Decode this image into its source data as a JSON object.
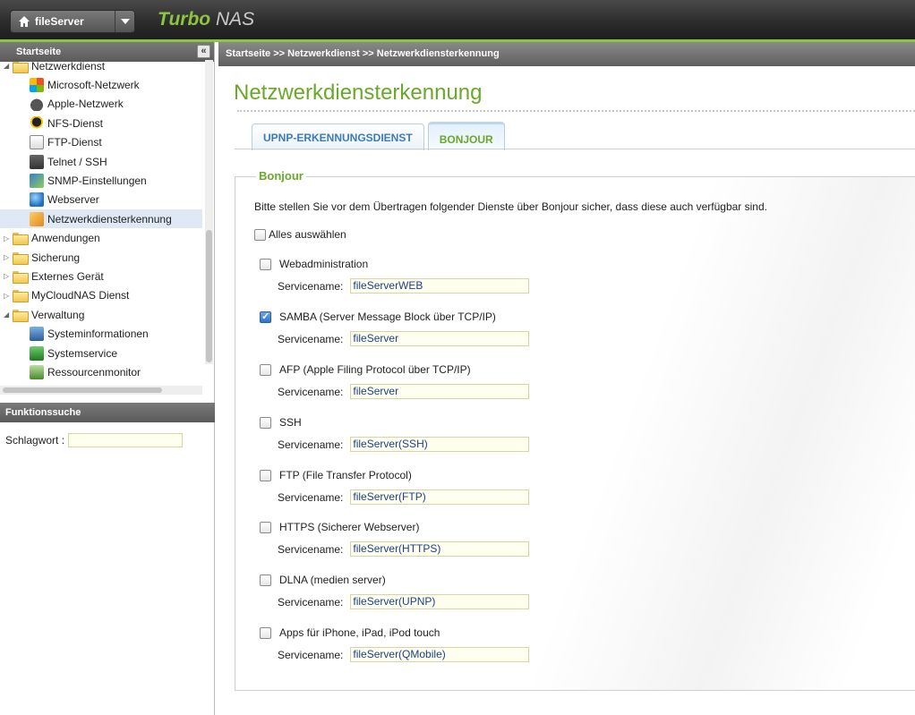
{
  "header": {
    "server_name": "fileServer",
    "brand_main": "Turbo",
    "brand_sub": "NAS"
  },
  "sidebar": {
    "title": "Startseite",
    "collapse_glyph": "«",
    "items": [
      {
        "label": "Netzwerkdienst",
        "type": "folder",
        "expanded": true
      },
      {
        "label": "Microsoft-Netzwerk",
        "type": "leaf",
        "icon": "windows-icon"
      },
      {
        "label": "Apple-Netzwerk",
        "type": "leaf",
        "icon": "apple-icon"
      },
      {
        "label": "NFS-Dienst",
        "type": "leaf",
        "icon": "linux-icon"
      },
      {
        "label": "FTP-Dienst",
        "type": "leaf",
        "icon": "ftp-icon"
      },
      {
        "label": "Telnet / SSH",
        "type": "leaf",
        "icon": "terminal-icon"
      },
      {
        "label": "SNMP-Einstellungen",
        "type": "leaf",
        "icon": "snmp-icon"
      },
      {
        "label": "Webserver",
        "type": "leaf",
        "icon": "globe-icon"
      },
      {
        "label": "Netzwerkdiensterkennung",
        "type": "leaf",
        "icon": "discovery-icon",
        "selected": true
      },
      {
        "label": "Anwendungen",
        "type": "folder",
        "expanded": false
      },
      {
        "label": "Sicherung",
        "type": "folder",
        "expanded": false
      },
      {
        "label": "Externes Gerät",
        "type": "folder",
        "expanded": false
      },
      {
        "label": "MyCloudNAS Dienst",
        "type": "folder",
        "expanded": false
      },
      {
        "label": "Verwaltung",
        "type": "folder",
        "expanded": true
      },
      {
        "label": "Systeminformationen",
        "type": "leaf",
        "icon": "sysinfo-icon"
      },
      {
        "label": "Systemservice",
        "type": "leaf",
        "icon": "sysservice-icon"
      },
      {
        "label": "Ressourcenmonitor",
        "type": "leaf",
        "icon": "monitor-icon"
      }
    ]
  },
  "search": {
    "title": "Funktionssuche",
    "label": "Schlagwort :",
    "value": ""
  },
  "breadcrumb": "Startseite >> Netzwerkdienst >> Netzwerkdiensterkennung",
  "page": {
    "title": "Netzwerkdiensterkennung",
    "tabs": [
      {
        "label": "UPNP-ERKENNUNGSDIENST",
        "active": false
      },
      {
        "label": "BONJOUR",
        "active": true
      }
    ],
    "legend": "Bonjour",
    "description": "Bitte stellen Sie vor dem Übertragen folgender Dienste über Bonjour sicher, dass diese auch verfügbar sind.",
    "select_all_label": "Alles auswählen",
    "select_all_checked": false,
    "service_name_label": "Servicename:",
    "services": [
      {
        "label": "Webadministration",
        "checked": false,
        "service_name": "fileServerWEB"
      },
      {
        "label": "SAMBA (Server Message Block über TCP/IP)",
        "checked": true,
        "service_name": "fileServer"
      },
      {
        "label": "AFP (Apple Filing Protocol über TCP/IP)",
        "checked": false,
        "service_name": "fileServer"
      },
      {
        "label": "SSH",
        "checked": false,
        "service_name": "fileServer(SSH)"
      },
      {
        "label": "FTP (File Transfer Protocol)",
        "checked": false,
        "service_name": "fileServer(FTP)"
      },
      {
        "label": "HTTPS (Sicherer Webserver)",
        "checked": false,
        "service_name": "fileServer(HTTPS)"
      },
      {
        "label": "DLNA (medien server)",
        "checked": false,
        "service_name": "fileServer(UPNP)"
      },
      {
        "label": "Apps für iPhone, iPad, iPod touch",
        "checked": false,
        "service_name": "fileServer(QMobile)"
      }
    ]
  },
  "colors": {
    "accent_green": "#6aa82a",
    "tab_blue": "#3b7bbf",
    "selected_row": "#dfe9f5"
  }
}
